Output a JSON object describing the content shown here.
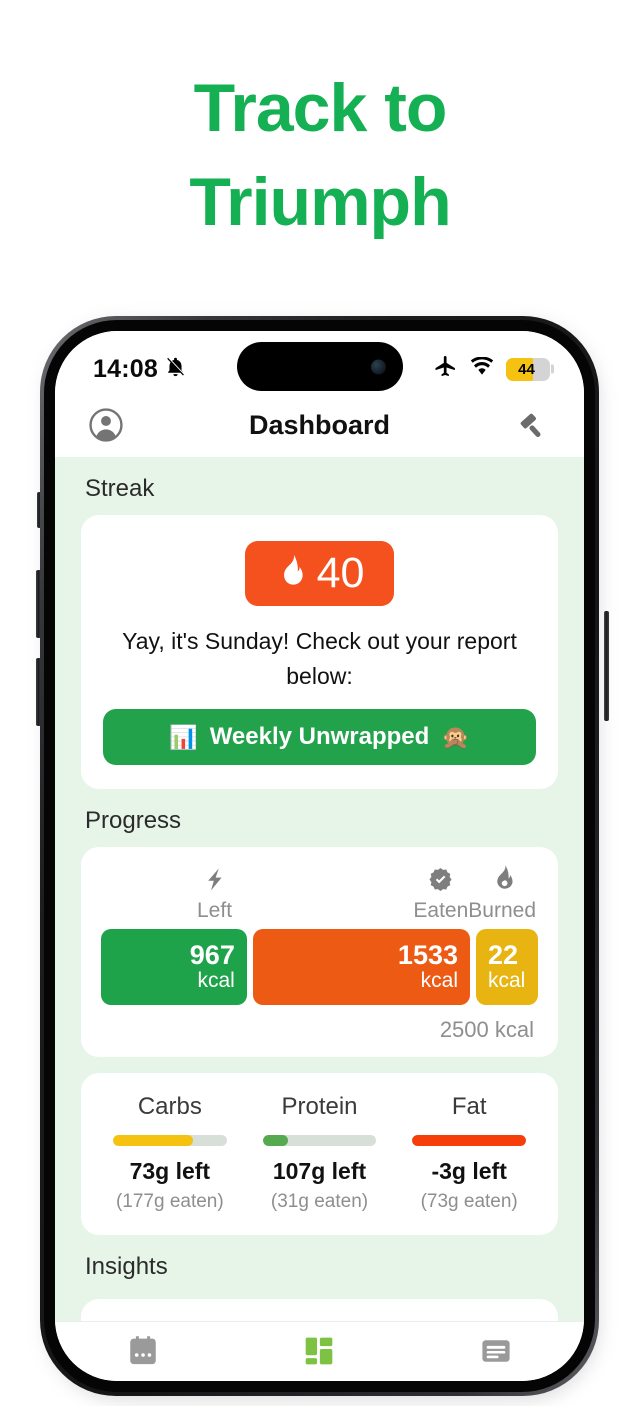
{
  "hero": {
    "line1": "Track to",
    "line2": "Triumph",
    "color": "#14b053"
  },
  "phone": {
    "status_bar": {
      "time": "14:08",
      "silent_icon": "bell-slash-icon",
      "airplane_icon": "airplane-icon",
      "wifi_icon": "wifi-icon",
      "battery_percent": "44",
      "battery_level": 44,
      "battery_color": "#f5c211"
    },
    "nav": {
      "profile_icon": "profile-avatar-icon",
      "title": "Dashboard",
      "right_icon": "gavel-icon"
    },
    "sections": {
      "streak": {
        "label": "Streak",
        "badge": {
          "icon": "flame-icon",
          "value": "40",
          "color": "#f4511e"
        },
        "message": "Yay, it's Sunday! Check out your report below:",
        "button": {
          "emoji_left": "📊",
          "label": "Weekly Unwrapped",
          "emoji_right": "🙊",
          "color": "#22a24b"
        }
      },
      "progress": {
        "label": "Progress",
        "legend": [
          {
            "icon": "lightning-bolt-icon",
            "label": "Left"
          },
          {
            "icon": "check-badge-icon",
            "label": "Eaten"
          },
          {
            "icon": "flame-icon",
            "label": "Burned"
          }
        ],
        "segments": [
          {
            "name": "left",
            "value": "967",
            "unit": "kcal",
            "color": "#1fa34a"
          },
          {
            "name": "eaten",
            "value": "1533",
            "unit": "kcal",
            "color": "#ec5a13"
          },
          {
            "name": "burned",
            "value": "22",
            "unit": "kcal",
            "color": "#e8b411"
          }
        ],
        "total": "2500 kcal"
      },
      "macros": [
        {
          "name": "Carbs",
          "left": "73g left",
          "eaten": "(177g eaten)",
          "percent": 70,
          "color": "#f5c211"
        },
        {
          "name": "Protein",
          "left": "107g left",
          "eaten": "(31g eaten)",
          "percent": 22,
          "color": "#55aa4f"
        },
        {
          "name": "Fat",
          "left": "-3g left",
          "eaten": "(73g eaten)",
          "percent": 100,
          "color": "#f63e0b"
        }
      ],
      "insights": {
        "label": "Insights"
      }
    },
    "tabbar": [
      {
        "name": "calendar-tab",
        "icon": "calendar-icon",
        "active": false,
        "color": "#9a9a9a"
      },
      {
        "name": "dashboard-tab",
        "icon": "dashboard-grid-icon",
        "active": true,
        "color": "#7dc242"
      },
      {
        "name": "log-tab",
        "icon": "list-lines-icon",
        "active": false,
        "color": "#9a9a9a"
      }
    ]
  },
  "chart_data": {
    "type": "bar",
    "title": "Daily calorie budget",
    "categories": [
      "Left",
      "Eaten",
      "Burned"
    ],
    "values": [
      967,
      1533,
      22
    ],
    "unit": "kcal",
    "total": 2500,
    "ylabel": "kcal",
    "macros": {
      "categories": [
        "Carbs",
        "Protein",
        "Fat"
      ],
      "left_g": [
        73,
        107,
        -3
      ],
      "eaten_g": [
        177,
        31,
        73
      ],
      "percent_consumed": [
        70,
        22,
        100
      ]
    }
  }
}
